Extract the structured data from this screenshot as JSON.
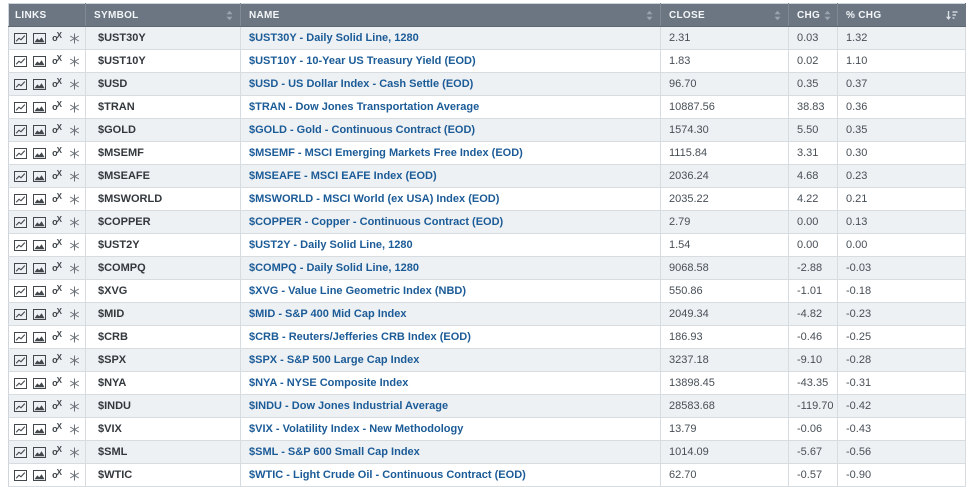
{
  "table": {
    "columns": {
      "links": "LINKS",
      "symbol": "SYMBOL",
      "name": "NAME",
      "close": "CLOSE",
      "chg": "CHG",
      "pct_chg": "% CHG"
    },
    "sort": {
      "active_column": "% CHG",
      "direction": "descending"
    },
    "link_icons": [
      "sharpchart-icon",
      "gallery-chart-icon",
      "point-and-figure-icon",
      "seasonality-icon"
    ],
    "rows": [
      {
        "symbol": "$UST30Y",
        "name": "$UST30Y - Daily Solid Line, 1280",
        "close": "2.31",
        "chg": "0.03",
        "pct": "1.32"
      },
      {
        "symbol": "$UST10Y",
        "name": "$UST10Y - 10-Year US Treasury Yield (EOD)",
        "close": "1.83",
        "chg": "0.02",
        "pct": "1.10"
      },
      {
        "symbol": "$USD",
        "name": "$USD - US Dollar Index - Cash Settle (EOD)",
        "close": "96.70",
        "chg": "0.35",
        "pct": "0.37"
      },
      {
        "symbol": "$TRAN",
        "name": "$TRAN - Dow Jones Transportation Average",
        "close": "10887.56",
        "chg": "38.83",
        "pct": "0.36"
      },
      {
        "symbol": "$GOLD",
        "name": "$GOLD - Gold - Continuous Contract (EOD)",
        "close": "1574.30",
        "chg": "5.50",
        "pct": "0.35"
      },
      {
        "symbol": "$MSEMF",
        "name": "$MSEMF - MSCI Emerging Markets Free Index (EOD)",
        "close": "1115.84",
        "chg": "3.31",
        "pct": "0.30"
      },
      {
        "symbol": "$MSEAFE",
        "name": "$MSEAFE - MSCI EAFE Index (EOD)",
        "close": "2036.24",
        "chg": "4.68",
        "pct": "0.23"
      },
      {
        "symbol": "$MSWORLD",
        "name": "$MSWORLD - MSCI World (ex USA) Index (EOD)",
        "close": "2035.22",
        "chg": "4.22",
        "pct": "0.21"
      },
      {
        "symbol": "$COPPER",
        "name": "$COPPER - Copper - Continuous Contract (EOD)",
        "close": "2.79",
        "chg": "0.00",
        "pct": "0.13"
      },
      {
        "symbol": "$UST2Y",
        "name": "$UST2Y - Daily Solid Line, 1280",
        "close": "1.54",
        "chg": "0.00",
        "pct": "0.00"
      },
      {
        "symbol": "$COMPQ",
        "name": "$COMPQ - Daily Solid Line, 1280",
        "close": "9068.58",
        "chg": "-2.88",
        "pct": "-0.03"
      },
      {
        "symbol": "$XVG",
        "name": "$XVG - Value Line Geometric Index (NBD)",
        "close": "550.86",
        "chg": "-1.01",
        "pct": "-0.18"
      },
      {
        "symbol": "$MID",
        "name": "$MID - S&P 400 Mid Cap Index",
        "close": "2049.34",
        "chg": "-4.82",
        "pct": "-0.23"
      },
      {
        "symbol": "$CRB",
        "name": "$CRB - Reuters/Jefferies CRB Index (EOD)",
        "close": "186.93",
        "chg": "-0.46",
        "pct": "-0.25"
      },
      {
        "symbol": "$SPX",
        "name": "$SPX - S&P 500 Large Cap Index",
        "close": "3237.18",
        "chg": "-9.10",
        "pct": "-0.28"
      },
      {
        "symbol": "$NYA",
        "name": "$NYA - NYSE Composite Index",
        "close": "13898.45",
        "chg": "-43.35",
        "pct": "-0.31"
      },
      {
        "symbol": "$INDU",
        "name": "$INDU - Dow Jones Industrial Average",
        "close": "28583.68",
        "chg": "-119.70",
        "pct": "-0.42"
      },
      {
        "symbol": "$VIX",
        "name": "$VIX - Volatility Index - New Methodology",
        "close": "13.79",
        "chg": "-0.06",
        "pct": "-0.43"
      },
      {
        "symbol": "$SML",
        "name": "$SML - S&P 600 Small Cap Index",
        "close": "1014.09",
        "chg": "-5.67",
        "pct": "-0.56"
      },
      {
        "symbol": "$WTIC",
        "name": "$WTIC - Light Crude Oil - Continuous Contract (EOD)",
        "close": "62.70",
        "chg": "-0.57",
        "pct": "-0.90"
      }
    ]
  },
  "colors": {
    "header_bg": "#6b7682",
    "row_alt_bg": "#eef1f4",
    "link_blue": "#1b5b97",
    "grid_line": "#d7dce1"
  }
}
